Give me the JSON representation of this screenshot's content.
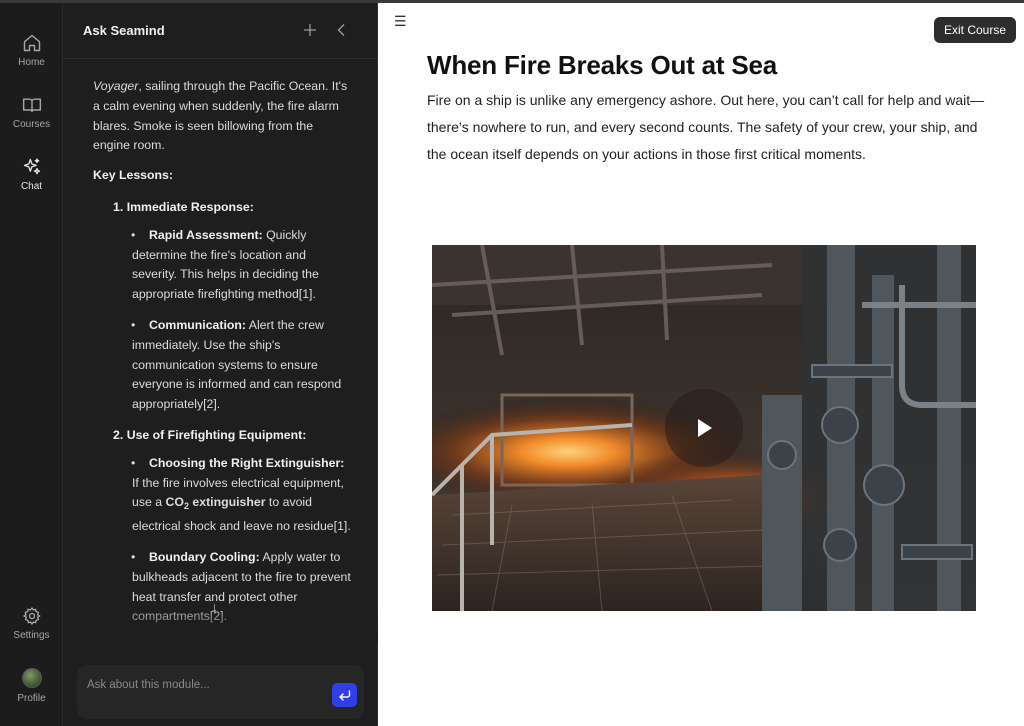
{
  "nav": {
    "home": "Home",
    "courses": "Courses",
    "chat": "Chat",
    "settings": "Settings",
    "profile": "Profile"
  },
  "chat": {
    "title": "Ask Seamind",
    "intro_vessel": "Voyager",
    "intro_rest": ", sailing through the Pacific Ocean. It's a calm evening when suddenly, the fire alarm blares. Smoke is seen billowing from the engine room.",
    "key_lessons": "Key Lessons:",
    "lessons": [
      {
        "number": "1.",
        "title": "Immediate Response:",
        "bullets": [
          {
            "title": "Rapid Assessment:",
            "text": " Quickly determine the fire's location and severity. This helps in deciding the appropriate firefighting method[1]."
          },
          {
            "title": "Communication:",
            "text": " Alert the crew immediately. Use the ship's communication systems to ensure everyone is informed and can respond appropriately[2]."
          }
        ]
      },
      {
        "number": "2.",
        "title": "Use of Firefighting Equipment:",
        "bullets": [
          {
            "title": "Choosing the Right Extinguisher:",
            "text_before": " If the fire involves electrical equipment, use a ",
            "bold_co": "CO",
            "bold_sub": "2",
            "bold_after": " extinguisher",
            "text_after": " to avoid electrical shock and leave no residue[1]."
          },
          {
            "title": "Boundary Cooling:",
            "text": " Apply water to bulkheads adjacent to the fire to prevent heat transfer and protect other compartments[2]."
          }
        ]
      }
    ],
    "input_placeholder": "Ask about this module...",
    "scroll_arrow": "↓"
  },
  "main": {
    "exit_label": "Exit Course",
    "title": "When Fire Breaks Out at Sea",
    "intro": "Fire on a ship is unlike any emergency ashore. Out here, you can’t call for help and wait—there’s nowhere to run, and every second counts. The safety of your crew, your ship, and the ocean itself depends on your actions in those first critical moments."
  },
  "colors": {
    "sidebar_bg": "#1c1c1c",
    "chat_bg": "#1e1e1e",
    "accent": "#2f3ee6",
    "exit_bg": "#2d2d2d"
  },
  "icons": [
    "home-icon",
    "book-icon",
    "sparkle-icon",
    "gear-icon",
    "plus-icon",
    "chevron-left-icon",
    "send-icon",
    "menu-icon",
    "play-icon",
    "arrow-down-icon"
  ]
}
